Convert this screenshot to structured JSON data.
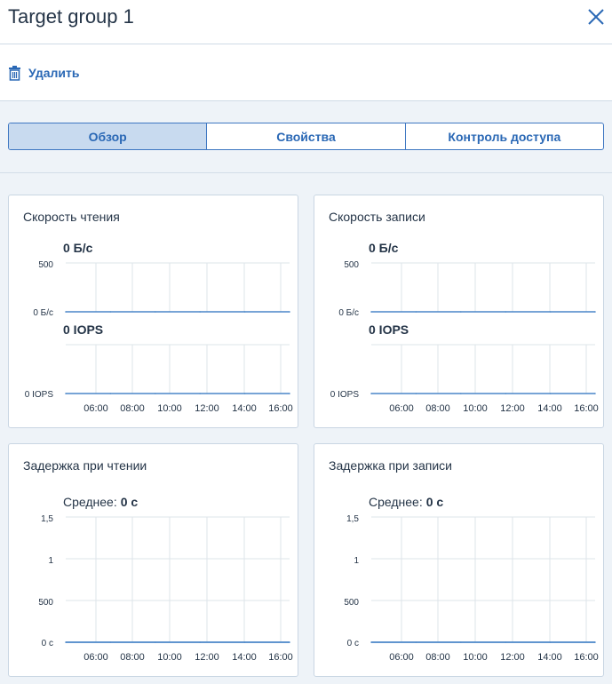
{
  "header": {
    "title": "Target group 1",
    "close_icon": "close-icon"
  },
  "toolbar": {
    "delete_label": "Удалить",
    "delete_icon": "trash-icon"
  },
  "tabs": [
    {
      "label": "Обзор",
      "active": true
    },
    {
      "label": "Свойства",
      "active": false
    },
    {
      "label": "Контроль доступа",
      "active": false
    }
  ],
  "colors": {
    "accent": "#2a68b5",
    "line": "#4a86c8",
    "grid": "#dde4ea"
  },
  "x_ticks": [
    "06:00",
    "08:00",
    "10:00",
    "12:00",
    "14:00",
    "16:00"
  ],
  "cards": {
    "read_speed": {
      "title": "Скорость чтения",
      "throughput_value": "0 Б/с",
      "throughput_ticks": [
        "500",
        "0 Б/с"
      ],
      "iops_value": "0 IOPS",
      "iops_ticks": [
        "0 IOPS"
      ]
    },
    "write_speed": {
      "title": "Скорость записи",
      "throughput_value": "0 Б/с",
      "throughput_ticks": [
        "500",
        "0 Б/с"
      ],
      "iops_value": "0 IOPS",
      "iops_ticks": [
        "0 IOPS"
      ]
    },
    "read_latency": {
      "title": "Задержка при чтении",
      "avg_label": "Среднее:",
      "avg_value": "0 с",
      "y_ticks": [
        "1,5",
        "1",
        "500",
        "0 с"
      ]
    },
    "write_latency": {
      "title": "Задержка при записи",
      "avg_label": "Среднее:",
      "avg_value": "0 с",
      "y_ticks": [
        "1,5",
        "1",
        "500",
        "0 с"
      ]
    }
  },
  "chart_data": [
    {
      "type": "line",
      "title": "Скорость чтения",
      "x": [
        "06:00",
        "08:00",
        "10:00",
        "12:00",
        "14:00",
        "16:00"
      ],
      "series": [
        {
          "values": [
            0,
            0,
            0,
            0,
            0,
            0
          ]
        },
        {
          "values": [
            0,
            0,
            0,
            0,
            0,
            0
          ]
        }
      ],
      "ylim": [
        0,
        500
      ],
      "grid": true
    },
    {
      "type": "line",
      "title": "Скорость записи",
      "x": [
        "06:00",
        "08:00",
        "10:00",
        "12:00",
        "14:00",
        "16:00"
      ],
      "series": [
        {
          "values": [
            0,
            0,
            0,
            0,
            0,
            0
          ]
        },
        {
          "values": [
            0,
            0,
            0,
            0,
            0,
            0
          ]
        }
      ],
      "ylim": [
        0,
        500
      ],
      "grid": true
    },
    {
      "type": "line",
      "title": "Задержка при чтении",
      "x": [
        "06:00",
        "08:00",
        "10:00",
        "12:00",
        "14:00",
        "16:00"
      ],
      "series": [
        {
          "values": [
            0,
            0,
            0,
            0,
            0,
            0
          ]
        }
      ],
      "y_tick_labels": [
        "0 с",
        "500",
        "1",
        "1,5"
      ],
      "grid": true
    },
    {
      "type": "line",
      "title": "Задержка при записи",
      "x": [
        "06:00",
        "08:00",
        "10:00",
        "12:00",
        "14:00",
        "16:00"
      ],
      "series": [
        {
          "values": [
            0,
            0,
            0,
            0,
            0,
            0
          ]
        }
      ],
      "y_tick_labels": [
        "0 с",
        "500",
        "1",
        "1,5"
      ],
      "grid": true
    }
  ]
}
